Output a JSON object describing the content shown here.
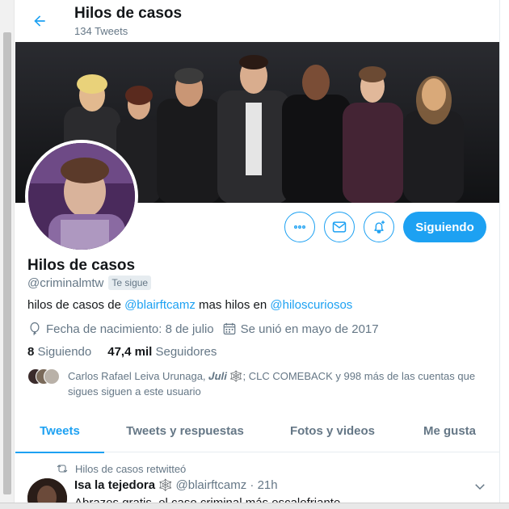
{
  "header": {
    "back_icon": "arrow-left-icon",
    "title": "Hilos de casos",
    "tweet_count": "134 Tweets"
  },
  "profile": {
    "name": "Hilos de casos",
    "handle": "@criminalmtw",
    "follows_you": "Te sigue",
    "bio": {
      "part1": "hilos de casos de ",
      "link1": "@blairftcamz",
      "part2": " mas hilos en ",
      "link2": "@hiloscuriosos"
    },
    "birthday": "Fecha de nacimiento: 8 de julio",
    "joined": "Se unió en mayo de 2017",
    "following_count": "8",
    "following_label": "Siguiendo",
    "followers_count": "47,4 mil",
    "followers_label": "Seguidores",
    "known_followers_text": "Carlos Rafael Leiva Urunaga, 𝑱𝒖𝒍𝒊 🕸️; CLC COMEBACK y 998 más de las cuentas que sigues siguen a este usuario"
  },
  "actions": {
    "more_icon": "more-icon",
    "dm_icon": "envelope-icon",
    "notify_icon": "bell-plus-icon",
    "following_button": "Siguiendo"
  },
  "tabs": [
    {
      "label": "Tweets",
      "active": true
    },
    {
      "label": "Tweets y respuestas",
      "active": false
    },
    {
      "label": "Fotos y videos",
      "active": false
    },
    {
      "label": "Me gusta",
      "active": false
    }
  ],
  "tweet": {
    "retweet_label": "Hilos de casos retwitteó",
    "author": "Isa la tejedora",
    "author_deco": "🕸️",
    "meta": "@blairftcamz · 21h",
    "text": "Abrazos gratis, el caso criminal más escalofriante"
  },
  "colors": {
    "accent": "#1da1f2",
    "text": "#14171a",
    "muted": "#657786",
    "border": "#e6ecf0"
  }
}
